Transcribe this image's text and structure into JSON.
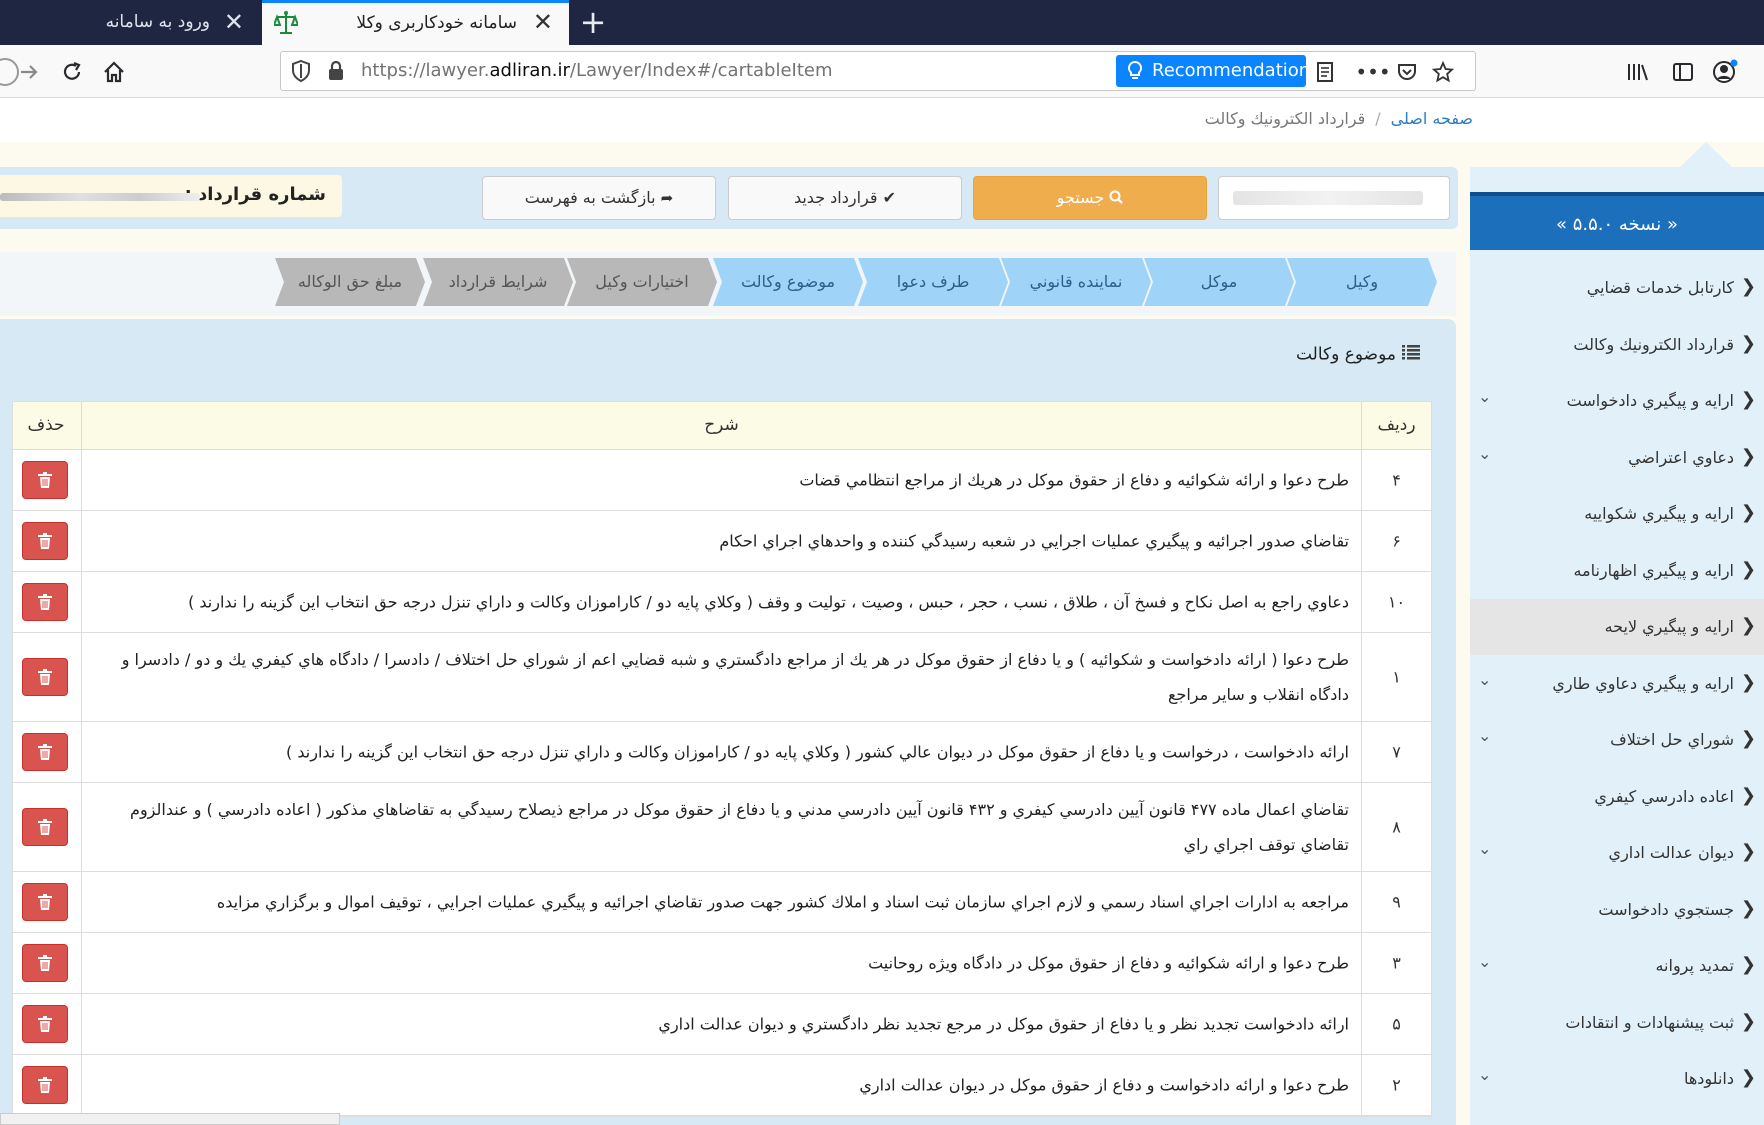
{
  "browser": {
    "tabs": [
      {
        "title": "ورود به سامانه"
      },
      {
        "title": "سامانه خودکاربری وکلا"
      }
    ],
    "url": {
      "prefix": "https://lawyer.",
      "domain": "adliran.ir",
      "path": "/Lawyer/Index#/cartableItem"
    },
    "recommendation_label": "Recommendation"
  },
  "breadcrumb": {
    "home": "صفحه اصلی",
    "separator": "/",
    "current": "قرارداد الكترونيك وكالت"
  },
  "sidebar": {
    "version": "« نسخه ۵.۵.۰ »",
    "items": [
      {
        "label": "كارتابل خدمات قضايي",
        "dropdown": false
      },
      {
        "label": "قرارداد الكترونيك وكالت",
        "dropdown": false
      },
      {
        "label": "ارايه و پيگيري دادخواست",
        "dropdown": true
      },
      {
        "label": "دعاوي اعتراضي",
        "dropdown": true
      },
      {
        "label": "ارايه و پيگيري شكواييه",
        "dropdown": false
      },
      {
        "label": "ارايه و پيگيري اظهارنامه",
        "dropdown": false
      },
      {
        "label": "ارايه و پيگيري لايحه",
        "dropdown": false,
        "active": true
      },
      {
        "label": "ارايه و پيگيري دعاوي طاري",
        "dropdown": true
      },
      {
        "label": "شوراي حل اختلاف",
        "dropdown": true
      },
      {
        "label": "اعاده دادرسي كيفري",
        "dropdown": false
      },
      {
        "label": "ديوان عدالت اداري",
        "dropdown": true
      },
      {
        "label": "جستجوي دادخواست",
        "dropdown": false
      },
      {
        "label": "تمديد پروانه",
        "dropdown": true
      },
      {
        "label": "ثبت پيشنهادات و انتقادات",
        "dropdown": false
      },
      {
        "label": "دانلودها",
        "dropdown": true
      }
    ]
  },
  "toolbar": {
    "search_label": "جستجو",
    "new_contract_label": "قرارداد جديد",
    "back_label": "بازگشت به فهرست",
    "contract_number_label": "شماره قرارداد :"
  },
  "wizard": {
    "steps": [
      {
        "label": "وكيل",
        "state": "on"
      },
      {
        "label": "موكل",
        "state": "on"
      },
      {
        "label": "نماينده قانوني",
        "state": "on"
      },
      {
        "label": "طرف دعوا",
        "state": "on"
      },
      {
        "label": "موضوع وكالت",
        "state": "on"
      },
      {
        "label": "اختيارات وكيل",
        "state": "off"
      },
      {
        "label": "شرايط قرارداد",
        "state": "off"
      },
      {
        "label": "مبلغ حق الوكاله",
        "state": "off"
      }
    ]
  },
  "section": {
    "title": "موضوع وكالت"
  },
  "table": {
    "headers": {
      "row": "رديف",
      "description": "شرح",
      "delete": "حذف"
    },
    "rows": [
      {
        "row": "۴",
        "description": "طرح دعوا و ارائه شكوائيه و دفاع از حقوق موكل در هريك از مراجع انتظامي قضات"
      },
      {
        "row": "۶",
        "description": "تقاضاي صدور اجرائيه و پيگيري عمليات اجرايي در شعبه رسيدگي كننده و واحدهاي اجراي احكام"
      },
      {
        "row": "۱۰",
        "description": "دعاوي راجع به اصل نكاح و فسخ آن ، طلاق ، نسب ، حجر ، حبس ، وصيت ، توليت و وقف ( وكلاي پايه دو / كاراموزان وكالت و داراي تنزل درجه حق انتخاب اين گزينه را ندارند )"
      },
      {
        "row": "۱",
        "description": "طرح دعوا ( ارائه دادخواست و شكوائيه ) و يا دفاع از حقوق موكل در هر يك از مراجع دادگستري و شبه قضايي اعم از شوراي حل اختلاف / دادسرا / دادگاه هاي كيفري يك و دو / دادسرا و دادگاه انقلاب و ساير مراجع"
      },
      {
        "row": "۷",
        "description": "ارائه دادخواست ، درخواست و يا دفاع از حقوق موكل در ديوان عالي كشور ( وكلاي پايه دو / كاراموزان وكالت و داراي تنزل درجه حق انتخاب اين گزينه را ندارند )"
      },
      {
        "row": "۸",
        "description": "تقاضاي اعمال ماده ۴۷۷ قانون آيين دادرسي كيفري و ۴۳۲ قانون آيين دادرسي مدني و يا دفاع از حقوق موكل در مراجع ذيصلاح رسيدگي به تقاضاهاي مذكور ( اعاده دادرسي ) و عندالزوم تقاضاي توقف اجراي راي"
      },
      {
        "row": "۹",
        "description": "مراجعه به ادارات اجراي اسناد رسمي و لازم اجراي سازمان ثبت اسناد و املاك كشور جهت صدور تقاضاي اجرائيه و پيگيري عمليات اجرايي ، توقيف اموال و برگزاري مزايده"
      },
      {
        "row": "۳",
        "description": "طرح دعوا و ارائه شكوائيه و دفاع از حقوق موكل در دادگاه ويژه روحانيت"
      },
      {
        "row": "۵",
        "description": "ارائه دادخواست تجديد نظر و يا دفاع از حقوق موكل در مرجع تجديد نظر دادگستري و ديوان عدالت اداري"
      },
      {
        "row": "۲",
        "description": "طرح دعوا و ارائه دادخواست و دفاع از حقوق موكل در ديوان عدالت اداري"
      }
    ]
  }
}
